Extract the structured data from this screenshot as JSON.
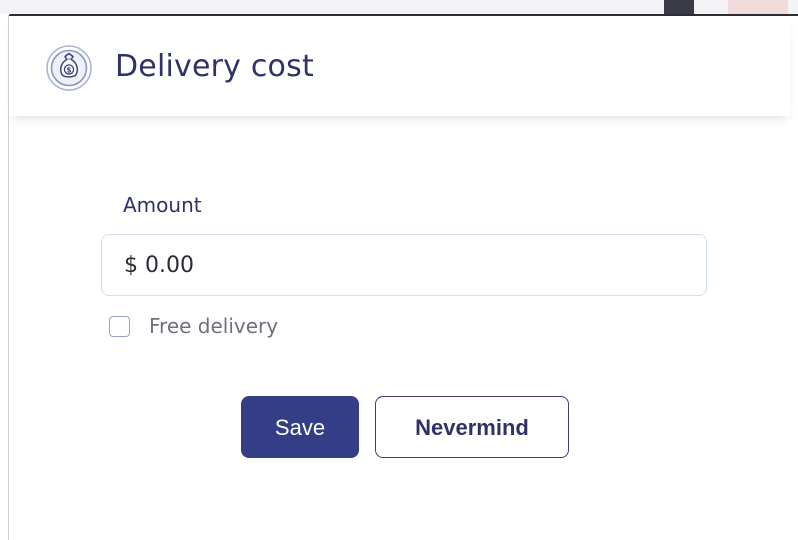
{
  "dialog": {
    "title": "Delivery cost",
    "icon": "money-bag-icon"
  },
  "amount": {
    "label": "Amount",
    "value": "$ 0.00"
  },
  "free_delivery": {
    "label": "Free delivery",
    "checked": false
  },
  "actions": {
    "save_label": "Save",
    "cancel_label": "Nevermind"
  },
  "colors": {
    "primary": "#343e86",
    "title_text": "#2f3268",
    "input_border": "#d5e0ef"
  }
}
